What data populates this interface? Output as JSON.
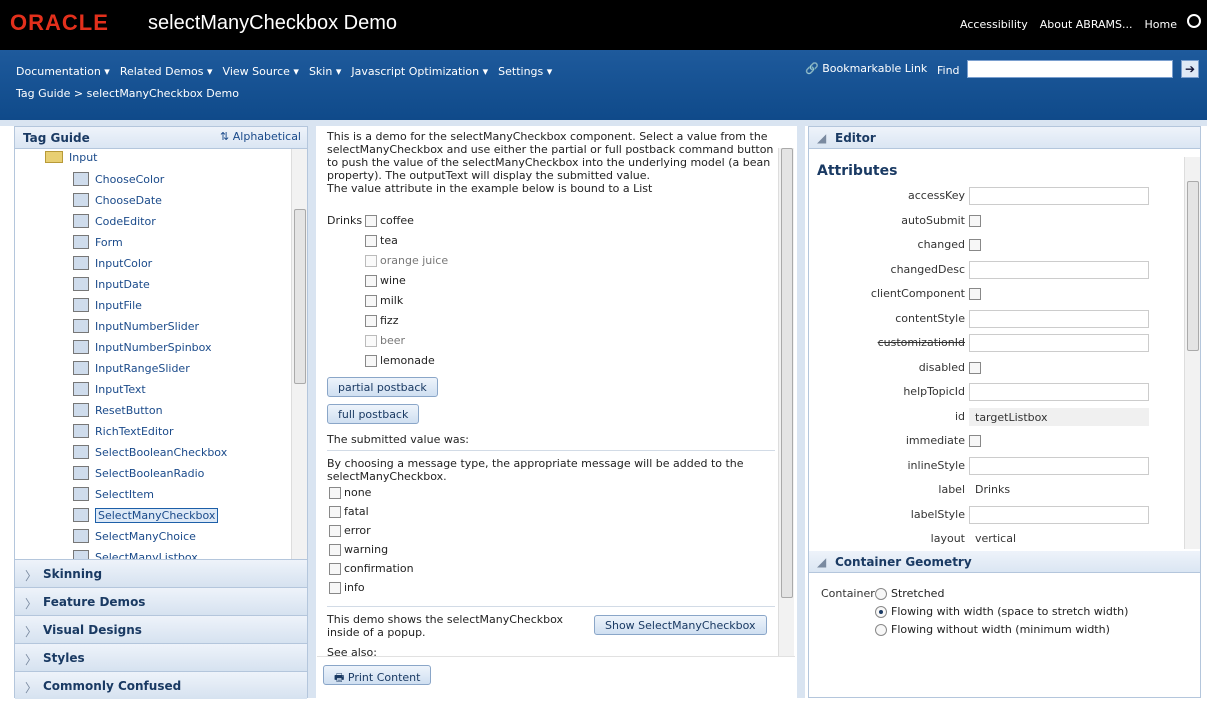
{
  "header": {
    "logo": "ORACLE",
    "title": "selectManyCheckbox Demo",
    "links": [
      "Accessibility",
      "About ABRAMS...",
      "Home"
    ]
  },
  "menubar": {
    "menus": [
      "Documentation ▾",
      "Related Demos ▾",
      "View Source ▾",
      "Skin ▾",
      "Javascript Optimization ▾",
      "Settings ▾"
    ],
    "breadcrumb": "Tag Guide > selectManyCheckbox Demo",
    "bookmark": "Bookmarkable Link",
    "find_label": "Find",
    "find_value": ""
  },
  "left": {
    "title": "Tag Guide",
    "alpha_label": "Alphabetical",
    "folder": "Input",
    "items": [
      {
        "label": "ChooseColor",
        "icon": "choose-color-icon"
      },
      {
        "label": "ChooseDate",
        "icon": "choose-date-icon"
      },
      {
        "label": "CodeEditor",
        "icon": "code-editor-icon"
      },
      {
        "label": "Form",
        "icon": "form-icon"
      },
      {
        "label": "InputColor",
        "icon": "input-color-icon"
      },
      {
        "label": "InputDate",
        "icon": "input-date-icon"
      },
      {
        "label": "InputFile",
        "icon": "input-file-icon"
      },
      {
        "label": "InputNumberSlider",
        "icon": "input-number-slider-icon"
      },
      {
        "label": "InputNumberSpinbox",
        "icon": "input-number-spinbox-icon"
      },
      {
        "label": "InputRangeSlider",
        "icon": "input-range-slider-icon"
      },
      {
        "label": "InputText",
        "icon": "input-text-icon"
      },
      {
        "label": "ResetButton",
        "icon": "reset-button-icon"
      },
      {
        "label": "RichTextEditor",
        "icon": "rich-text-editor-icon"
      },
      {
        "label": "SelectBooleanCheckbox",
        "icon": "select-boolean-checkbox-icon"
      },
      {
        "label": "SelectBooleanRadio",
        "icon": "select-boolean-radio-icon"
      },
      {
        "label": "SelectItem",
        "icon": "select-item-icon"
      },
      {
        "label": "SelectManyCheckbox",
        "icon": "select-many-checkbox-icon",
        "selected": true
      },
      {
        "label": "SelectManyChoice",
        "icon": "select-many-choice-icon"
      },
      {
        "label": "SelectManyListbox",
        "icon": "select-many-listbox-icon"
      }
    ],
    "accordions": [
      "Skinning",
      "Feature Demos",
      "Visual Designs",
      "Styles",
      "Commonly Confused"
    ]
  },
  "center": {
    "intro": "This is a demo for the selectManyCheckbox component. Select a value from the selectManyCheckbox and use either the partial or full postback command button to push the value of the selectManyCheckbox into the underlying model (a bean property). The outputText will display the submitted value.",
    "intro2": "The value attribute in the example below is bound to a List",
    "drinks_label": "Drinks",
    "drinks": [
      {
        "label": "coffee",
        "disabled": false
      },
      {
        "label": "tea",
        "disabled": false
      },
      {
        "label": "orange juice",
        "disabled": true
      },
      {
        "label": "wine",
        "disabled": false
      },
      {
        "label": "milk",
        "disabled": false
      },
      {
        "label": "fizz",
        "disabled": false
      },
      {
        "label": "beer",
        "disabled": true
      },
      {
        "label": "lemonade",
        "disabled": false
      }
    ],
    "partial_btn": "partial postback",
    "full_btn": "full postback",
    "submitted": "The submitted value was:",
    "msg_intro": "By choosing a message type, the appropriate message will be added to the selectManyCheckbox.",
    "msgs": [
      "none",
      "fatal",
      "error",
      "warning",
      "confirmation",
      "info"
    ],
    "popup_text": "This demo shows the selectManyCheckbox inside of a popup.",
    "popup_btn": "Show SelectManyCheckbox",
    "see_also": "See also:",
    "print_btn": "Print Content"
  },
  "right": {
    "editor_title": "Editor",
    "attr_title": "Attributes",
    "attrs": [
      {
        "label": "accessKey",
        "type": "input",
        "value": ""
      },
      {
        "label": "autoSubmit",
        "type": "checkbox"
      },
      {
        "label": "changed",
        "type": "checkbox"
      },
      {
        "label": "changedDesc",
        "type": "input",
        "value": ""
      },
      {
        "label": "clientComponent",
        "type": "checkbox"
      },
      {
        "label": "contentStyle",
        "type": "input",
        "value": ""
      },
      {
        "label": "customizationId",
        "type": "input",
        "value": "",
        "strike": true
      },
      {
        "label": "disabled",
        "type": "checkbox"
      },
      {
        "label": "helpTopicId",
        "type": "input",
        "value": ""
      },
      {
        "label": "id",
        "type": "readonly",
        "value": "targetListbox"
      },
      {
        "label": "immediate",
        "type": "checkbox"
      },
      {
        "label": "inlineStyle",
        "type": "input",
        "value": ""
      },
      {
        "label": "label",
        "type": "text",
        "value": "Drinks"
      },
      {
        "label": "labelStyle",
        "type": "input",
        "value": ""
      },
      {
        "label": "layout",
        "type": "text",
        "value": "vertical"
      }
    ],
    "geo_title": "Container Geometry",
    "geo_label": "Container",
    "geo_options": [
      {
        "label": "Stretched",
        "selected": false
      },
      {
        "label": "Flowing with width (space to stretch width)",
        "selected": true
      },
      {
        "label": "Flowing without width (minimum width)",
        "selected": false
      }
    ]
  }
}
